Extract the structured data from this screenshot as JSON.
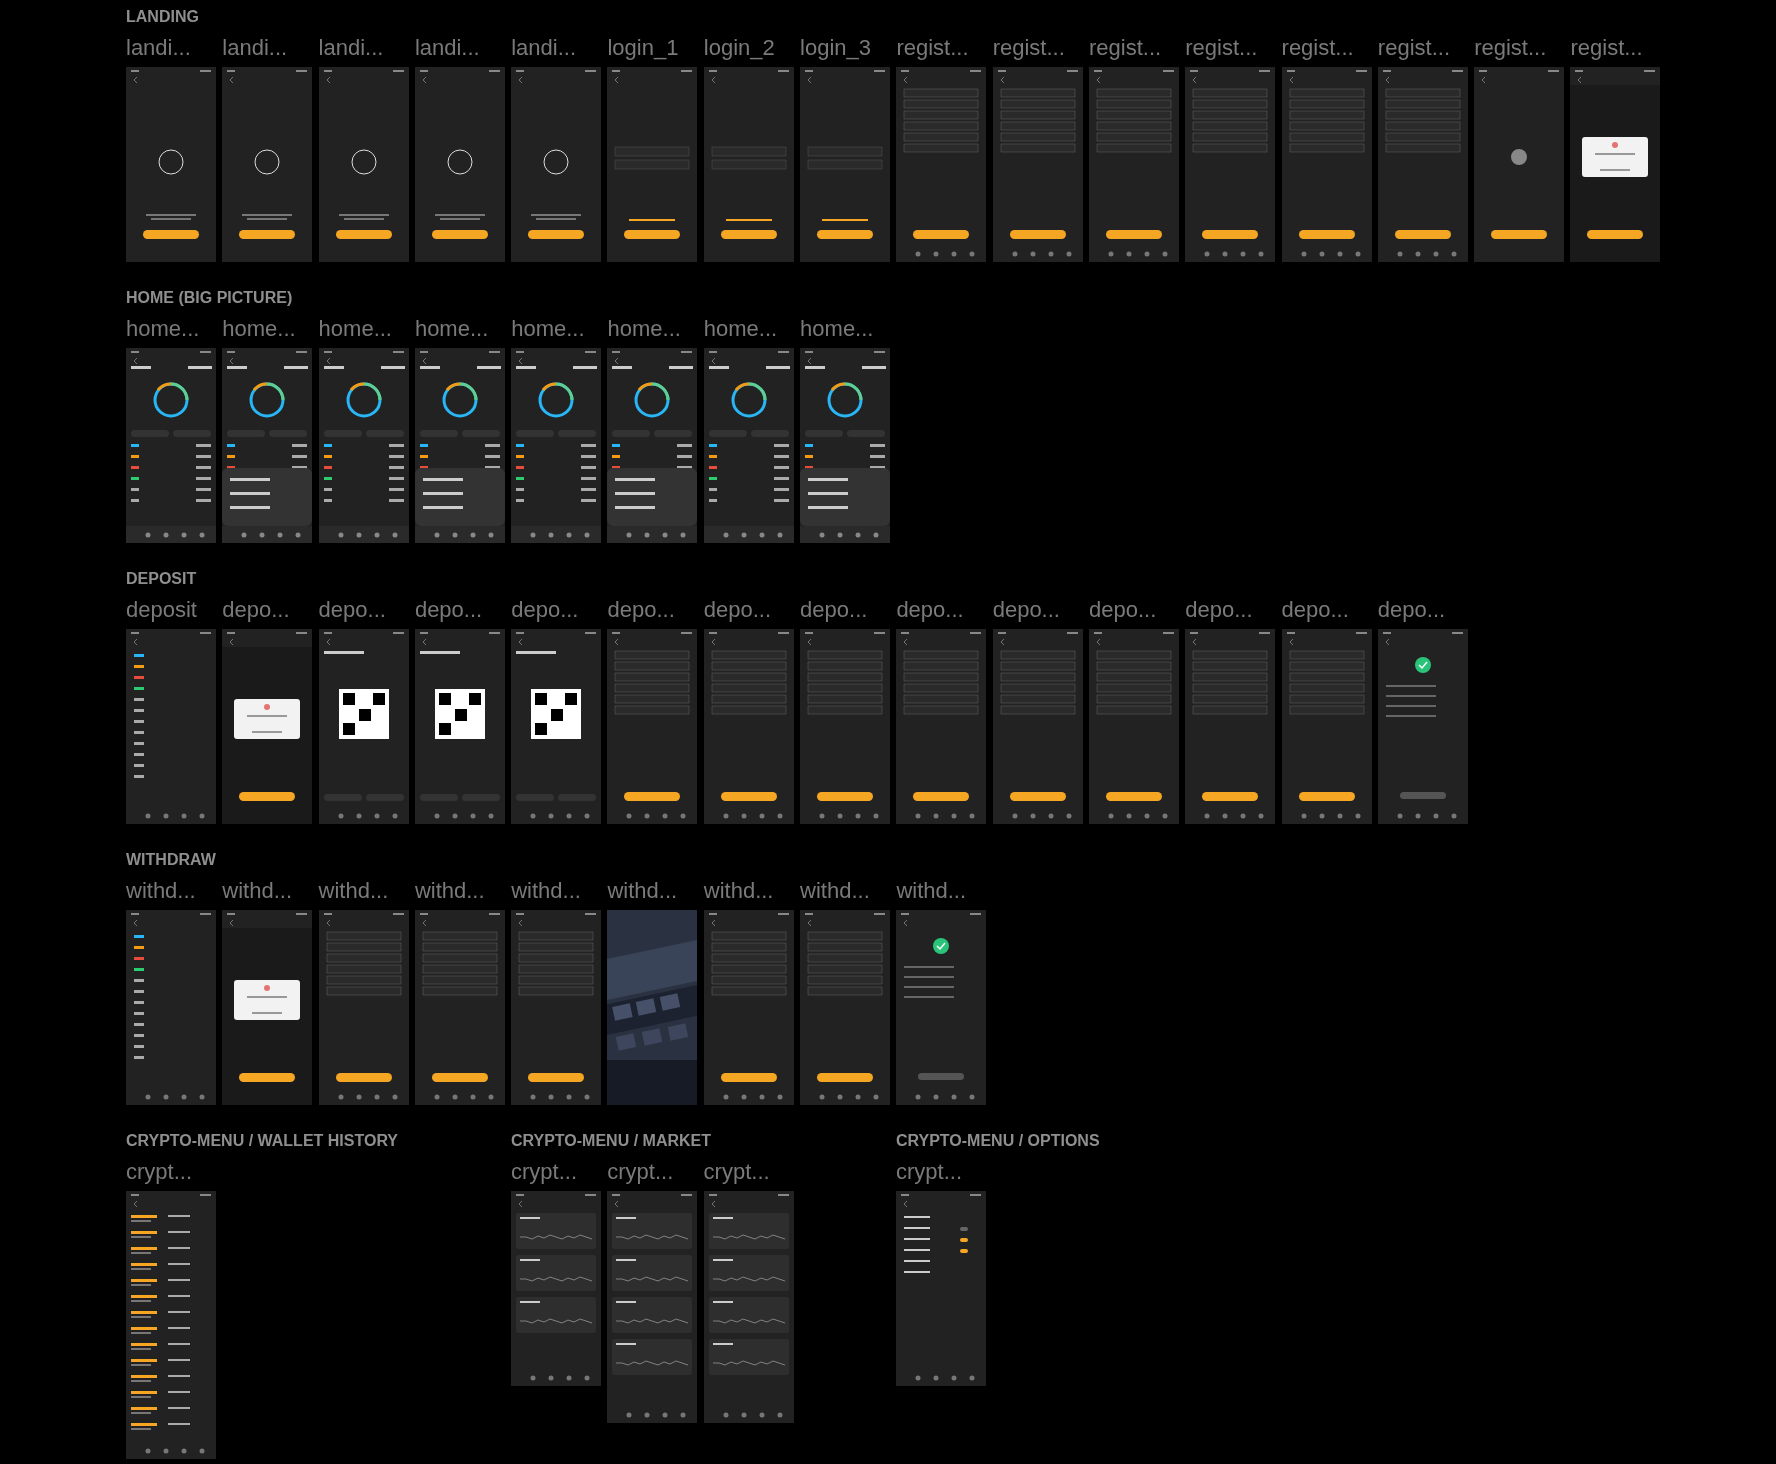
{
  "rows": [
    {
      "sections": [
        {
          "title": "LANDING",
          "frames": [
            {
              "label": "landi...",
              "kind": "intro"
            },
            {
              "label": "landi...",
              "kind": "intro"
            },
            {
              "label": "landi...",
              "kind": "intro"
            },
            {
              "label": "landi...",
              "kind": "intro"
            },
            {
              "label": "landi...",
              "kind": "intro"
            },
            {
              "label": "login_1",
              "kind": "login"
            },
            {
              "label": "login_2",
              "kind": "login"
            },
            {
              "label": "login_3",
              "kind": "login"
            },
            {
              "label": "regist...",
              "kind": "form"
            },
            {
              "label": "regist...",
              "kind": "form"
            },
            {
              "label": "regist...",
              "kind": "form"
            },
            {
              "label": "regist...",
              "kind": "form"
            },
            {
              "label": "regist...",
              "kind": "form"
            },
            {
              "label": "regist...",
              "kind": "form"
            },
            {
              "label": "regist...",
              "kind": "touch"
            },
            {
              "label": "regist...",
              "kind": "dialog"
            }
          ]
        }
      ]
    },
    {
      "sections": [
        {
          "title": "HOME (BIG PICTURE)",
          "frames": [
            {
              "label": "home...",
              "kind": "home"
            },
            {
              "label": "home...",
              "kind": "home-sheet"
            },
            {
              "label": "home...",
              "kind": "home"
            },
            {
              "label": "home...",
              "kind": "home-sheet"
            },
            {
              "label": "home...",
              "kind": "home"
            },
            {
              "label": "home...",
              "kind": "home-sheet"
            },
            {
              "label": "home...",
              "kind": "home"
            },
            {
              "label": "home...",
              "kind": "home-sheet"
            }
          ]
        }
      ]
    },
    {
      "sections": [
        {
          "title": "DEPOSIT",
          "frames": [
            {
              "label": "deposit",
              "kind": "currency-list"
            },
            {
              "label": "depo...",
              "kind": "dialog"
            },
            {
              "label": "depo...",
              "kind": "qr"
            },
            {
              "label": "depo...",
              "kind": "qr"
            },
            {
              "label": "depo...",
              "kind": "qr"
            },
            {
              "label": "depo...",
              "kind": "form"
            },
            {
              "label": "depo...",
              "kind": "form"
            },
            {
              "label": "depo...",
              "kind": "form"
            },
            {
              "label": "depo...",
              "kind": "form"
            },
            {
              "label": "depo...",
              "kind": "form"
            },
            {
              "label": "depo...",
              "kind": "form"
            },
            {
              "label": "depo...",
              "kind": "form"
            },
            {
              "label": "depo...",
              "kind": "form"
            },
            {
              "label": "depo...",
              "kind": "done"
            }
          ]
        }
      ]
    },
    {
      "sections": [
        {
          "title": "WITHDRAW",
          "frames": [
            {
              "label": "withd...",
              "kind": "currency-list"
            },
            {
              "label": "withd...",
              "kind": "dialog"
            },
            {
              "label": "withd...",
              "kind": "form"
            },
            {
              "label": "withd...",
              "kind": "form"
            },
            {
              "label": "withd...",
              "kind": "form"
            },
            {
              "label": "withd...",
              "kind": "camera"
            },
            {
              "label": "withd...",
              "kind": "form"
            },
            {
              "label": "withd...",
              "kind": "form"
            },
            {
              "label": "withd...",
              "kind": "done"
            }
          ]
        }
      ]
    },
    {
      "sections": [
        {
          "title": "CRYPTO-MENU / WALLET HISTORY",
          "frames": [
            {
              "label": "crypt...",
              "kind": "history"
            }
          ]
        },
        {
          "title": "CRYPTO-MENU / MARKET",
          "frames": [
            {
              "label": "crypt...",
              "kind": "market"
            },
            {
              "label": "crypt...",
              "kind": "market-long"
            },
            {
              "label": "crypt...",
              "kind": "market-long"
            }
          ]
        },
        {
          "title": "CRYPTO-MENU / OPTIONS",
          "frames": [
            {
              "label": "crypt...",
              "kind": "options"
            }
          ]
        }
      ]
    }
  ]
}
